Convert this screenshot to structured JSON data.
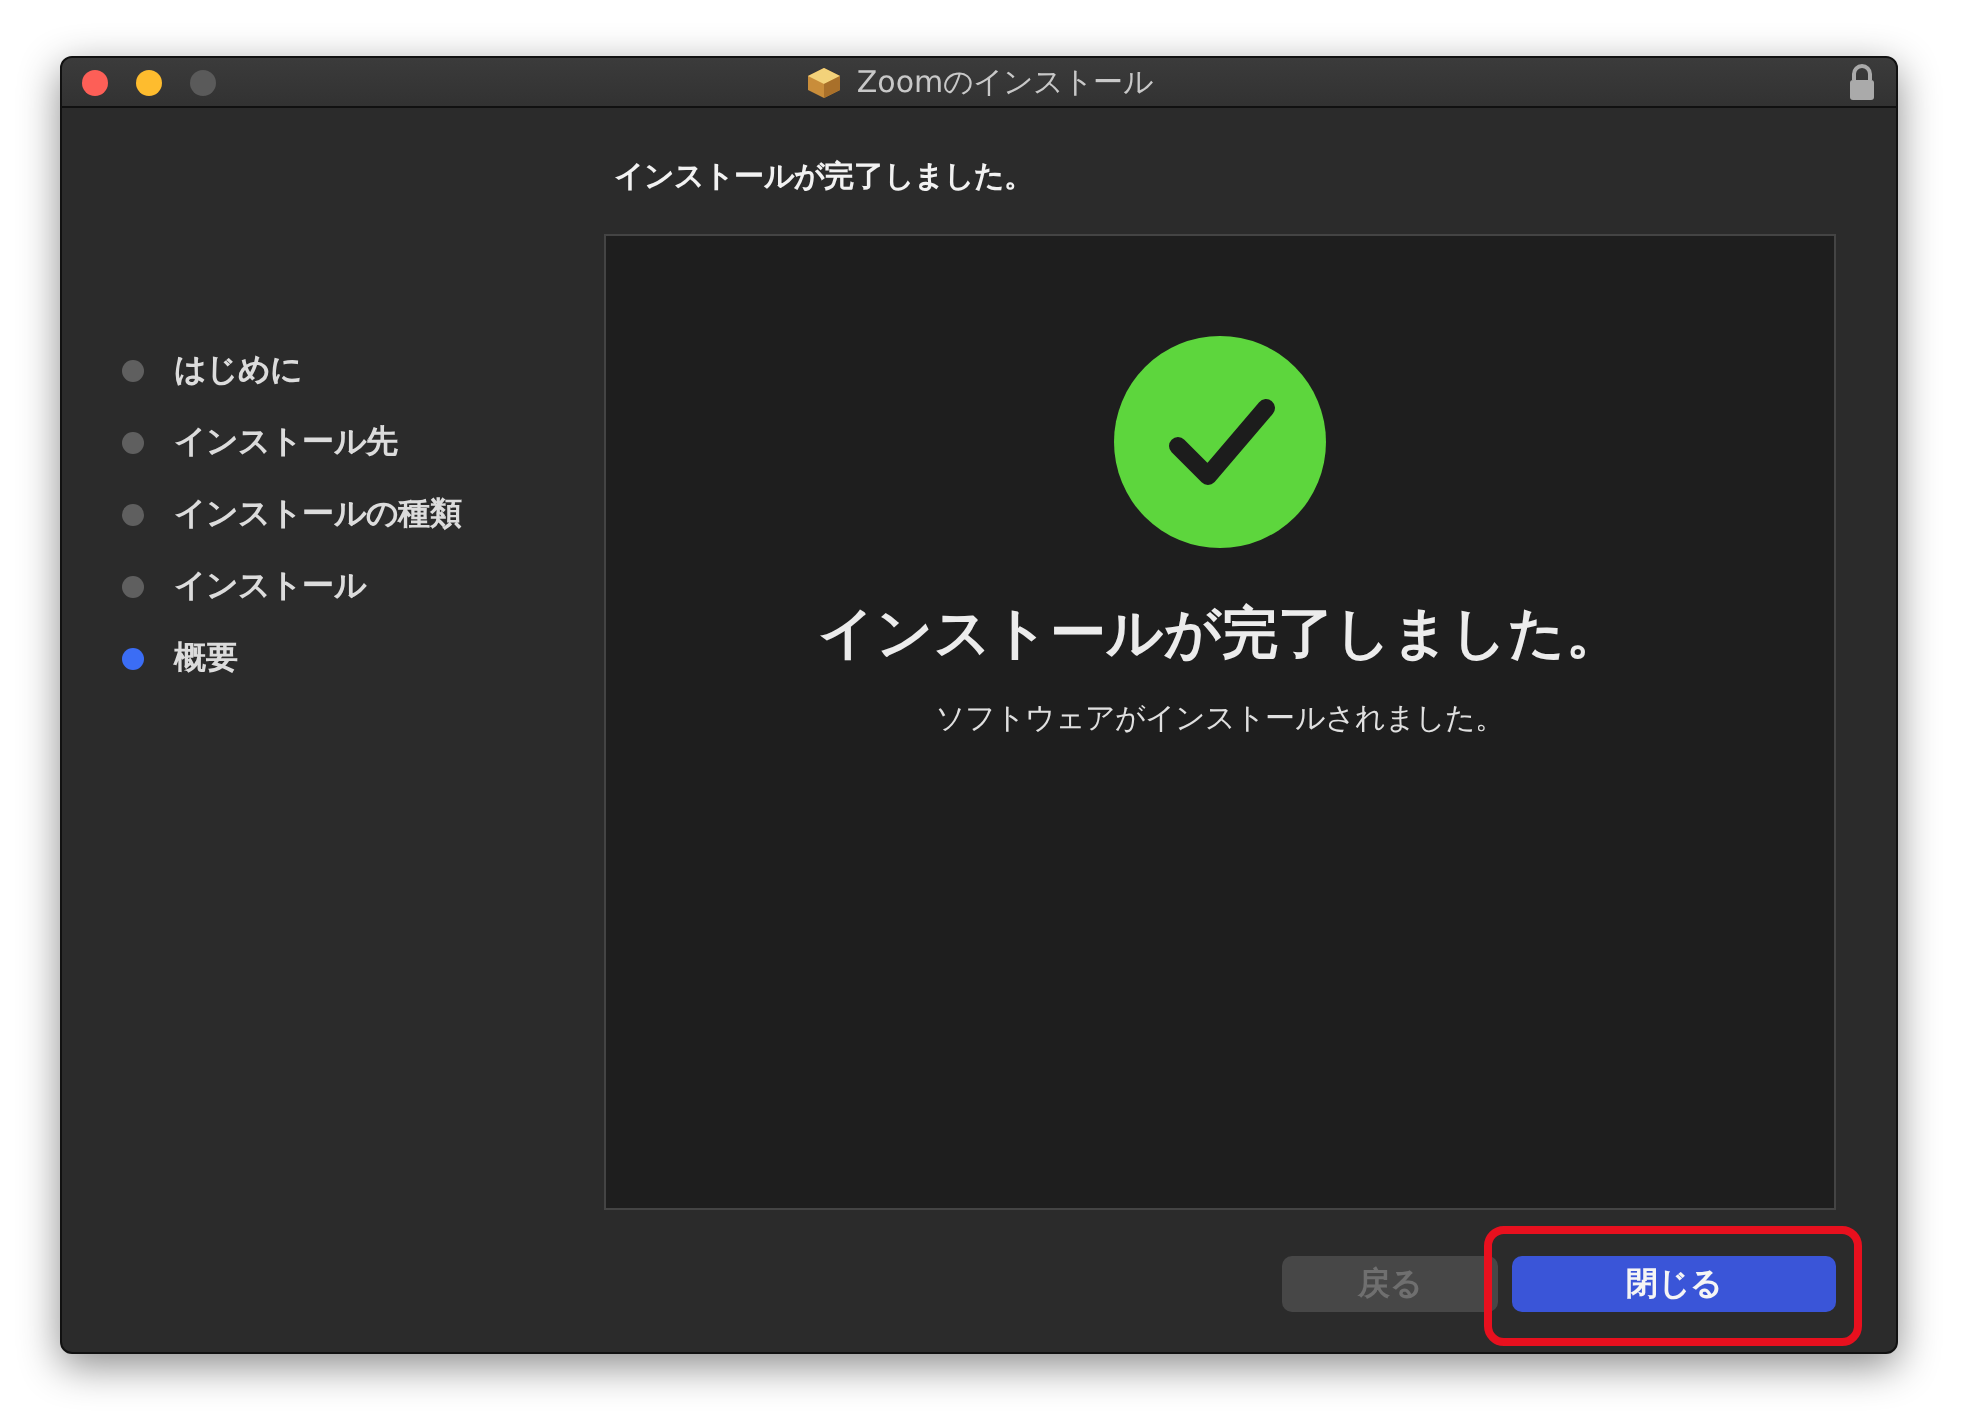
{
  "window": {
    "title": "Zoomのインストール"
  },
  "steps": [
    {
      "label": "はじめに",
      "selected": false
    },
    {
      "label": "インストール先",
      "selected": false
    },
    {
      "label": "インストールの種類",
      "selected": false
    },
    {
      "label": "インストール",
      "selected": false
    },
    {
      "label": "概要",
      "selected": true
    }
  ],
  "header": "インストールが完了しました。",
  "panel": {
    "heading": "インストールが完了しました。",
    "message": "ソフトウェアがインストールされました。"
  },
  "buttons": [
    {
      "label": "戻る",
      "disabled": true,
      "highlighted": false
    },
    {
      "label": "閉じる",
      "disabled": false,
      "highlighted": true
    }
  ]
}
